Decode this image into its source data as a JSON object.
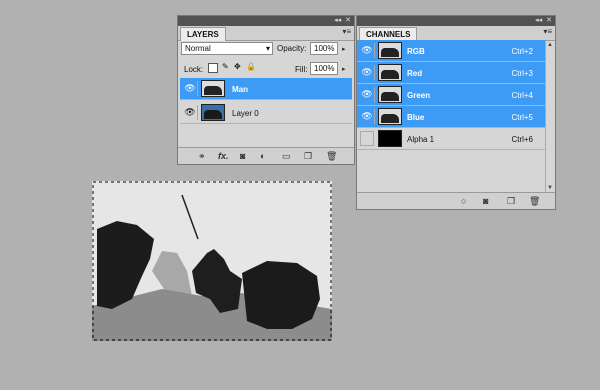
{
  "layers_panel": {
    "topbar_controls": [
      "◂◂",
      "✕"
    ],
    "tab": "LAYERS",
    "blend_mode": "Normal",
    "opacity_label": "Opacity:",
    "opacity_value": "100%",
    "lock_label": "Lock:",
    "fill_label": "Fill:",
    "fill_value": "100%",
    "layers": [
      {
        "name": "Man",
        "selected": true
      },
      {
        "name": "Layer 0",
        "selected": false
      }
    ]
  },
  "channels_panel": {
    "topbar_controls": [
      "◂◂",
      "✕"
    ],
    "tab": "CHANNELS",
    "channels": [
      {
        "name": "RGB",
        "shortcut": "Ctrl+2",
        "selected": true
      },
      {
        "name": "Red",
        "shortcut": "Ctrl+3",
        "selected": true
      },
      {
        "name": "Green",
        "shortcut": "Ctrl+4",
        "selected": true
      },
      {
        "name": "Blue",
        "shortcut": "Ctrl+5",
        "selected": true
      },
      {
        "name": "Alpha 1",
        "shortcut": "Ctrl+6",
        "selected": false
      }
    ]
  },
  "colors": {
    "selection_blue": "#3d9bf6",
    "panel_bg": "#d6d6d6",
    "workspace": "#b1b1b1"
  }
}
